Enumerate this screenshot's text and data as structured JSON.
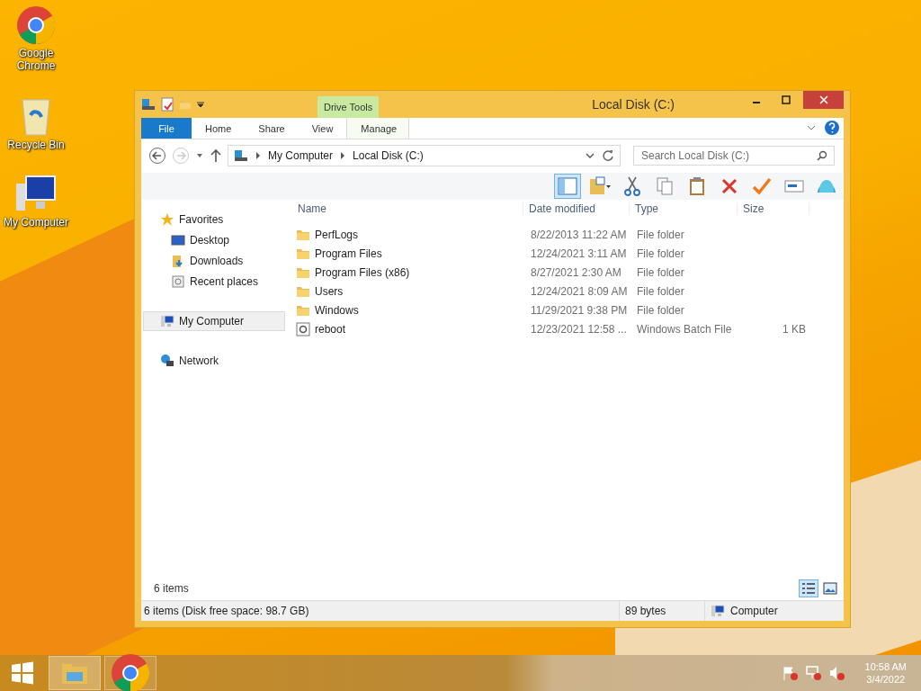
{
  "desktop_icons": [
    {
      "label": "Google Chrome",
      "kind": "chrome"
    },
    {
      "label": "Recycle Bin",
      "kind": "bin"
    },
    {
      "label": "My Computer",
      "kind": "computer"
    }
  ],
  "window": {
    "title": "Local Disk (C:)",
    "contextual_group": "Drive Tools",
    "ribbon_tabs": [
      {
        "label": "File",
        "kind": "file"
      },
      {
        "label": "Home",
        "kind": "normal"
      },
      {
        "label": "Share",
        "kind": "normal"
      },
      {
        "label": "View",
        "kind": "normal"
      },
      {
        "label": "Manage",
        "kind": "contextual"
      }
    ],
    "breadcrumbs": [
      "My Computer",
      "Local Disk (C:)"
    ],
    "search": {
      "placeholder": "Search Local Disk (C:)"
    },
    "nav": [
      {
        "label": "Favorites",
        "kind": "star",
        "selected": false,
        "children": [
          {
            "label": "Desktop",
            "kind": "desktop",
            "selected": false
          },
          {
            "label": "Downloads",
            "kind": "downloads",
            "selected": false
          },
          {
            "label": "Recent places",
            "kind": "recent",
            "selected": false
          }
        ]
      },
      {
        "label": "My Computer",
        "kind": "computer",
        "selected": true
      },
      {
        "label": "Network",
        "kind": "network",
        "selected": false
      }
    ],
    "columns": [
      "Name",
      "Date modified",
      "Type",
      "Size"
    ],
    "rows": [
      {
        "name": "PerfLogs",
        "date": "8/22/2013 11:22 AM",
        "type": "File folder",
        "kind": "folder"
      },
      {
        "name": "Program Files",
        "date": "12/24/2021 3:11 AM",
        "type": "File folder",
        "kind": "folder"
      },
      {
        "name": "Program Files (x86)",
        "date": "8/27/2021 2:30 AM",
        "type": "File folder",
        "kind": "folder"
      },
      {
        "name": "Users",
        "date": "12/24/2021 8:09 AM",
        "type": "File folder",
        "kind": "folder"
      },
      {
        "name": "Windows",
        "date": "11/29/2021 9:38 PM",
        "type": "File folder",
        "kind": "folder"
      },
      {
        "name": "reboot",
        "date": "12/23/2021 12:58 ...",
        "type": "Windows Batch File",
        "size": "1 KB",
        "kind": "batch"
      }
    ],
    "item_count": "6 items",
    "views": [
      {
        "kind": "details",
        "selected": true
      },
      {
        "kind": "large",
        "selected": false
      }
    ],
    "status_bar": {
      "summary": "6 items (Disk free space: 98.7 GB)",
      "size": "89 bytes",
      "location": "Computer"
    }
  },
  "taskbar": {
    "buttons": [
      {
        "kind": "explorer",
        "selected": true
      },
      {
        "kind": "chrome",
        "selected": false
      }
    ],
    "time": "10:58 AM",
    "date": "3/4/2022"
  }
}
